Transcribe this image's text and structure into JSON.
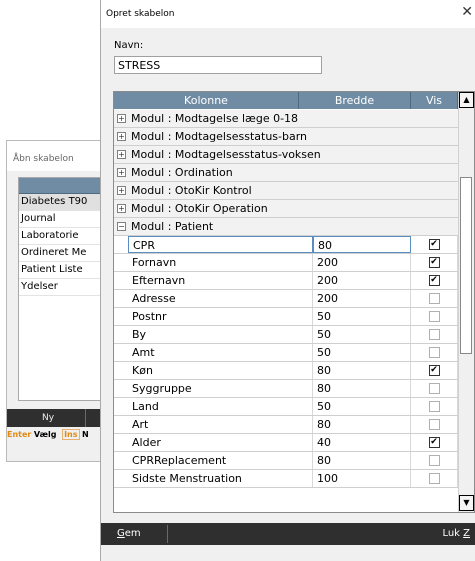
{
  "background_window": {
    "title": "Åbn skabelon",
    "items": [
      "Diabetes T90",
      "Journal",
      "Laboratorie",
      "Ordineret Me",
      "Patient Liste",
      "Ydelser"
    ],
    "button_label": "Ny",
    "hint_enter_key": "Enter",
    "hint_enter_text": "Vælg",
    "hint_ins_key": "Ins",
    "hint_ins_text": "N"
  },
  "dialog": {
    "title": "Opret skabelon",
    "close_glyph": "✕",
    "name_label": "Navn:",
    "name_value": "STRESS"
  },
  "grid": {
    "columns": [
      "Kolonne",
      "Bredde",
      "Vis"
    ],
    "modules_collapsed": [
      "Modul : Modtagelse læge 0-18",
      "Modul : Modtagelsesstatus-barn",
      "Modul : Modtagelsesstatus-voksen",
      "Modul : Ordination",
      "Modul : OtoKir Kontrol",
      "Modul : OtoKir Operation"
    ],
    "module_expanded": "Modul : Patient",
    "expand_glyph": "+",
    "collapse_glyph": "−",
    "rows": [
      {
        "name": "CPR",
        "width": "80",
        "visible": true
      },
      {
        "name": "Fornavn",
        "width": "200",
        "visible": true
      },
      {
        "name": "Efternavn",
        "width": "200",
        "visible": true
      },
      {
        "name": "Adresse",
        "width": "200",
        "visible": false
      },
      {
        "name": "Postnr",
        "width": "50",
        "visible": false
      },
      {
        "name": "By",
        "width": "50",
        "visible": false
      },
      {
        "name": "Amt",
        "width": "50",
        "visible": false
      },
      {
        "name": "Køn",
        "width": "80",
        "visible": true
      },
      {
        "name": "Syggruppe",
        "width": "80",
        "visible": false
      },
      {
        "name": "Land",
        "width": "50",
        "visible": false
      },
      {
        "name": "Art",
        "width": "80",
        "visible": false
      },
      {
        "name": "Alder",
        "width": "40",
        "visible": true
      },
      {
        "name": "CPRReplacement",
        "width": "80",
        "visible": false
      },
      {
        "name": "Sidste Menstruation",
        "width": "100",
        "visible": false
      }
    ]
  },
  "footer": {
    "save_label_mnemonic": "G",
    "save_label_rest": "em",
    "close_label_text": "Luk ",
    "close_label_mnemonic": "Z"
  }
}
